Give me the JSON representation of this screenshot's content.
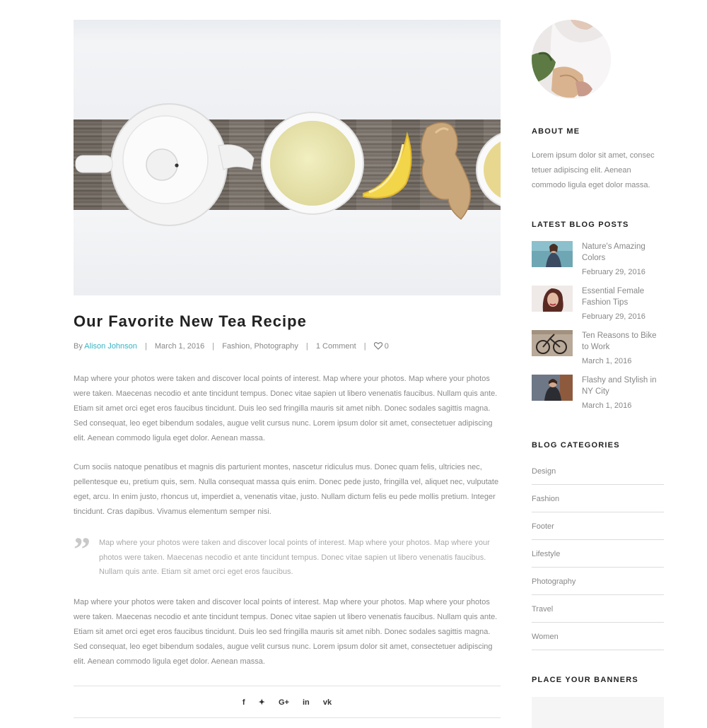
{
  "post": {
    "title": "Our Favorite New Tea Recipe",
    "meta": {
      "by": "By",
      "author": "Alison Johnson",
      "date": "March 1, 2016",
      "cat1": "Fashion",
      "comma": ",",
      "cat2": "Photography",
      "comments": "1 Comment",
      "likes": "0"
    },
    "paragraphs": [
      "Map where your photos were taken and discover local points of interest. Map where your photos. Map where your photos were taken. Maecenas necodio et ante tincidunt tempus. Donec vitae sapien ut libero venenatis faucibus. Nullam quis ante. Etiam sit amet orci eget eros faucibus tincidunt. Duis leo sed fringilla mauris sit amet nibh. Donec sodales sagittis magna. Sed consequat, leo eget bibendum sodales, augue velit cursus nunc. Lorem ipsum dolor sit amet, consectetuer adipiscing elit. Aenean commodo ligula eget dolor. Aenean massa.",
      "Cum sociis natoque penatibus et magnis dis parturient montes, nascetur ridiculus mus. Donec quam felis, ultricies nec, pellentesque eu, pretium quis, sem. Nulla consequat massa quis enim. Donec pede justo, fringilla vel, aliquet nec, vulputate eget, arcu. In enim justo, rhoncus ut, imperdiet a, venenatis vitae, justo. Nullam dictum felis eu pede mollis pretium. Integer tincidunt. Cras dapibus. Vivamus elementum semper nisi.",
      "Map where your photos were taken and discover local points of interest. Map where your photos. Map where your photos were taken. Maecenas necodio et ante tincidunt tempus. Donec vitae sapien ut libero venenatis faucibus. Nullam quis ante. Etiam sit amet orci eget eros faucibus tincidunt. Duis leo sed fringilla mauris sit amet nibh. Donec sodales sagittis magna. Sed consequat, leo eget bibendum sodales, augue velit cursus nunc. Lorem ipsum dolor sit amet, consectetuer adipiscing elit. Aenean commodo ligula eget dolor. Aenean massa."
    ],
    "quote": "Map where your photos were taken and discover local points of interest. Map where your photos. Map where your photos were taken. Maecenas necodio et ante tincidunt tempus. Donec vitae sapien ut libero venenatis faucibus. Nullam quis ante. Etiam sit amet orci eget eros faucibus.",
    "share_icons": [
      "facebook-icon",
      "twitter-icon",
      "google-plus-icon",
      "linkedin-icon",
      "vk-icon"
    ],
    "share_glyphs": [
      "f",
      "✦",
      "G+",
      "in",
      "vk"
    ]
  },
  "sidebar": {
    "about_title": "ABOUT ME",
    "about_text": "Lorem ipsum dolor sit amet, consec tetuer adipiscing elit. Aenean commodo ligula eget dolor massa.",
    "latest_title": "LATEST BLOG POSTS",
    "latest": [
      {
        "title": "Nature's Amazing Colors",
        "date": "February 29, 2016"
      },
      {
        "title": "Essential Female Fashion Tips",
        "date": "February 29, 2016"
      },
      {
        "title": "Ten Reasons to Bike to Work",
        "date": "March 1, 2016"
      },
      {
        "title": "Flashy and Stylish in NY City",
        "date": "March 1, 2016"
      }
    ],
    "categories_title": "BLOG CATEGORIES",
    "categories": [
      "Design",
      "Fashion",
      "Footer",
      "Lifestyle",
      "Photography",
      "Travel",
      "Women"
    ],
    "banners_title": "PLACE YOUR BANNERS"
  },
  "colors": {
    "accent": "#35b4c3",
    "heading": "#222222",
    "body_text": "#8a8a8a"
  }
}
